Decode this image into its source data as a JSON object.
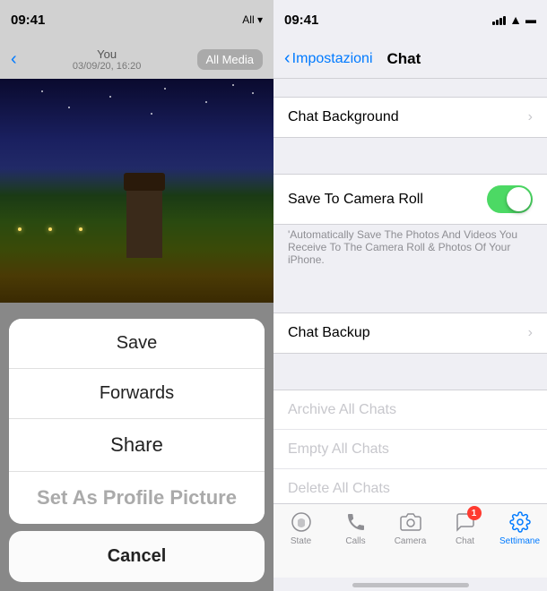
{
  "left": {
    "status_time": "09:41",
    "status_text": "All ▾",
    "header_you": "You",
    "header_date": "03/09/20, 16:20",
    "header_media": "All Media",
    "back_icon": "‹",
    "action_items": [
      {
        "id": "save",
        "label": "Save",
        "style": "normal"
      },
      {
        "id": "forward",
        "label": "Forwards",
        "style": "normal"
      },
      {
        "id": "share",
        "label": "Share",
        "style": "large"
      },
      {
        "id": "set-profile",
        "label": "Set As Profile Picture",
        "style": "bold-gray"
      }
    ],
    "cancel_label": "Cancel"
  },
  "right": {
    "status_time": "09:41",
    "back_label": "Impostazioni",
    "page_title": "Chat",
    "rows": [
      {
        "id": "chat-background",
        "label": "Chat Background",
        "type": "chevron",
        "disabled": false
      },
      {
        "id": "save-camera-roll",
        "label": "Save To Camera Roll",
        "type": "toggle",
        "toggle_on": true,
        "disabled": false
      },
      {
        "id": "camera-roll-desc",
        "label": "'Automatically Save The Photos And Videos You Receive To The Camera Roll & Photos Of Your iPhone.",
        "type": "description"
      },
      {
        "id": "chat-backup",
        "label": "Chat Backup",
        "type": "chevron",
        "disabled": false
      },
      {
        "id": "archive-all",
        "label": "Archive All Chats",
        "type": "plain",
        "disabled": true
      },
      {
        "id": "empty-all",
        "label": "Empty All Chats",
        "type": "plain",
        "disabled": true
      },
      {
        "id": "delete-all",
        "label": "Delete All Chats",
        "type": "plain",
        "disabled": true
      }
    ],
    "tabs": [
      {
        "id": "state",
        "label": "State",
        "icon": "💬",
        "active": false,
        "badge": null
      },
      {
        "id": "calls",
        "label": "Calls",
        "icon": "📞",
        "active": false,
        "badge": null
      },
      {
        "id": "camera",
        "label": "Camera",
        "icon": "📷",
        "active": false,
        "badge": null
      },
      {
        "id": "chat",
        "label": "Chat",
        "icon": "💬",
        "active": false,
        "badge": "1"
      },
      {
        "id": "settings",
        "label": "Settimane",
        "icon": "⚙️",
        "active": true,
        "badge": null
      }
    ]
  }
}
